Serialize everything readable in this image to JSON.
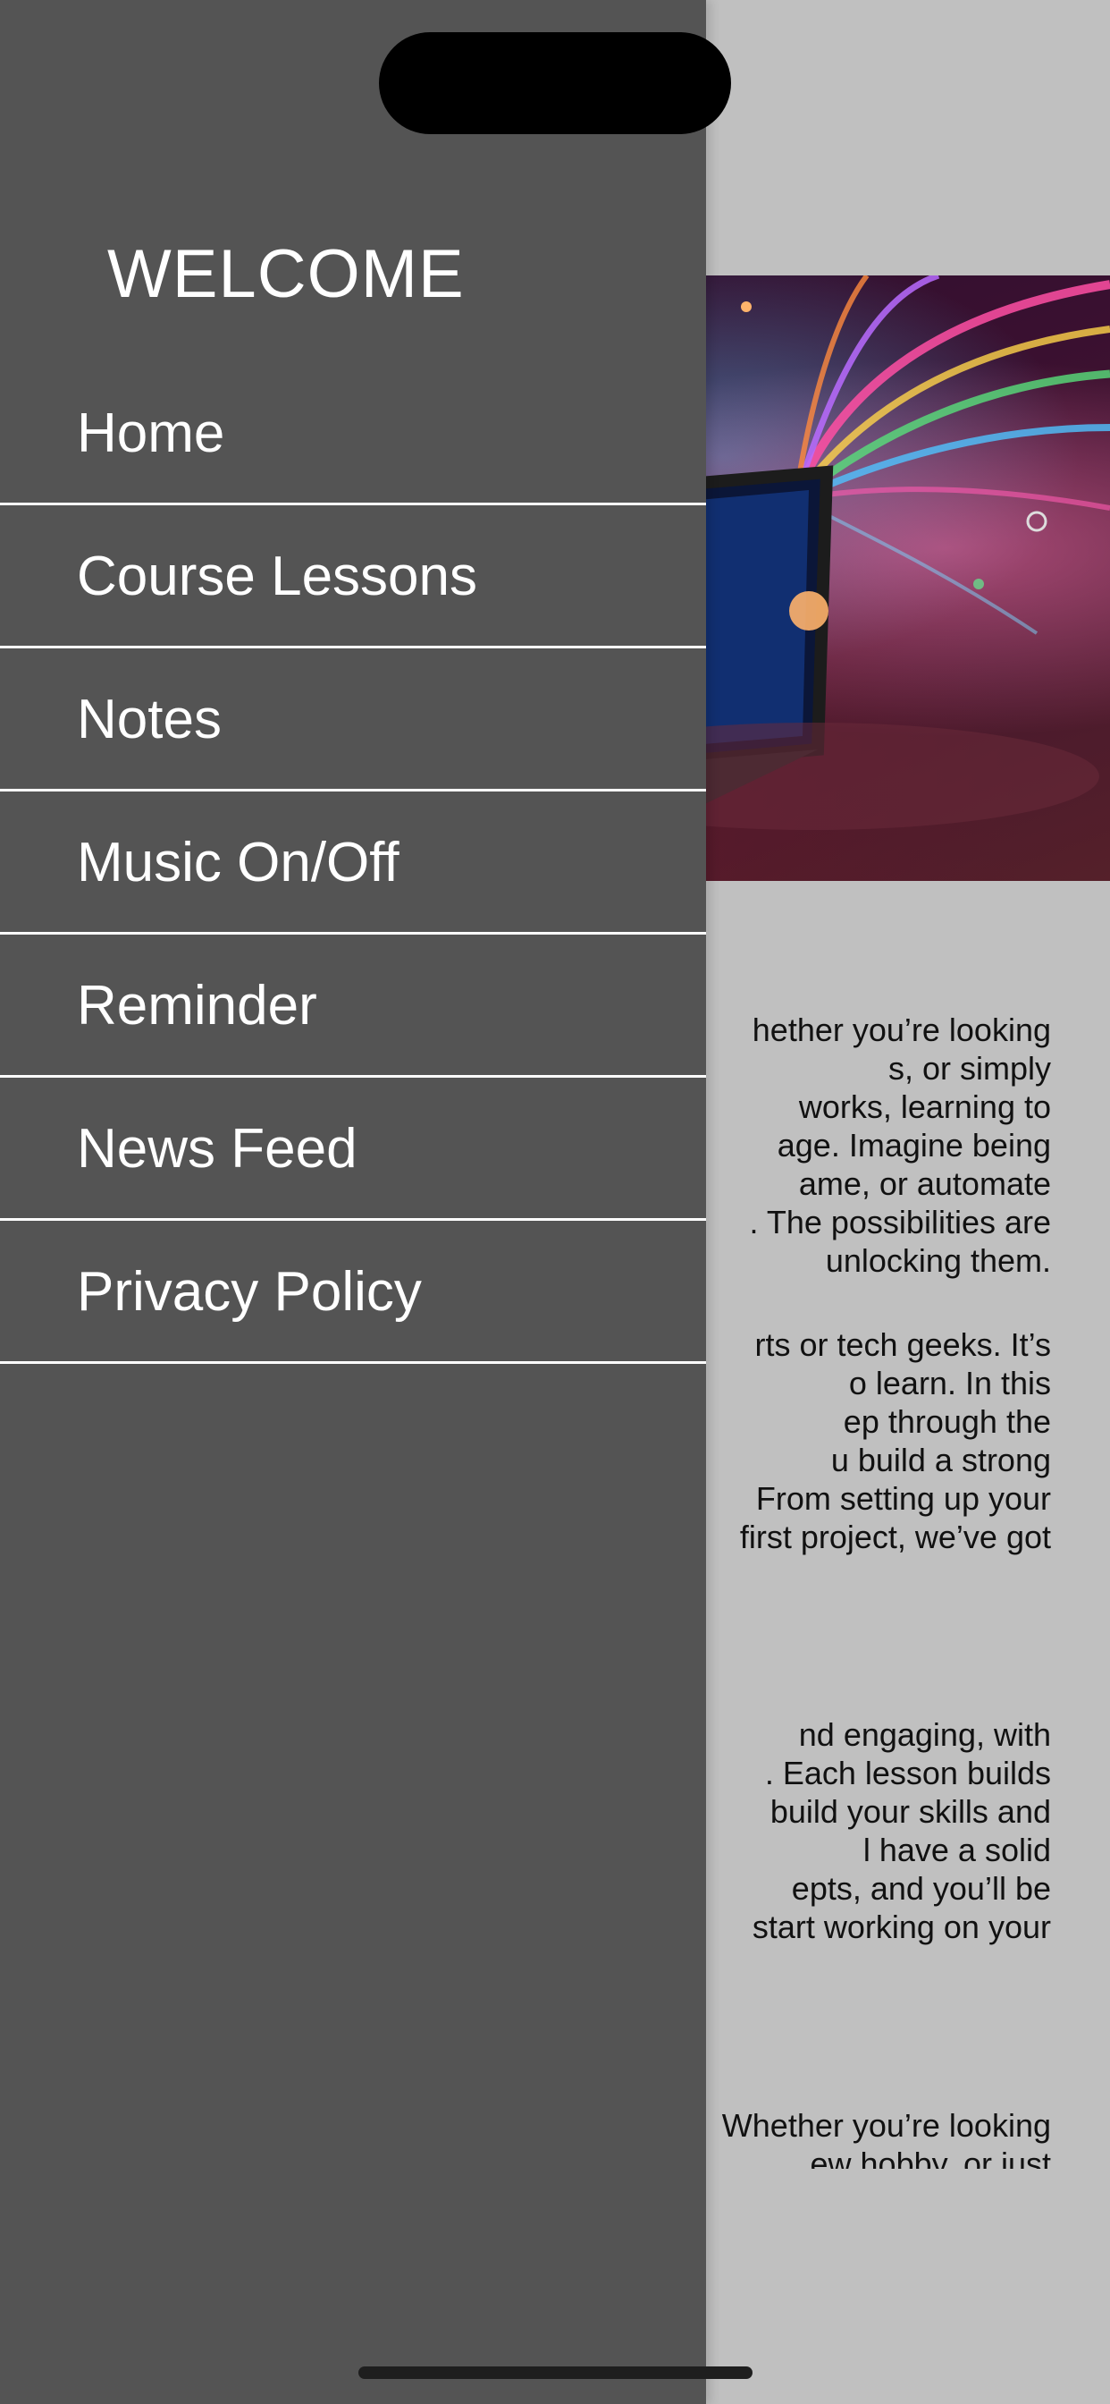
{
  "menu": {
    "title": "WELCOME",
    "items": [
      {
        "label": "Home"
      },
      {
        "label": "Course Lessons"
      },
      {
        "label": "Notes"
      },
      {
        "label": "Music On/Off"
      },
      {
        "label": "Reminder"
      },
      {
        "label": "News Feed"
      },
      {
        "label": "Privacy Policy"
      }
    ]
  },
  "content": {
    "paragraph_1": [
      "hether you’re looking",
      "s, or simply",
      "works, learning to",
      "age. Imagine being",
      "ame, or automate",
      ". The possibilities are",
      "unlocking them."
    ],
    "paragraph_2": [
      "rts or tech geeks. It’s",
      "o learn. In this",
      "ep through the",
      "u build a strong",
      "From setting up your",
      "first project, we’ve got"
    ],
    "paragraph_3": [
      "nd engaging, with",
      ". Each lesson builds",
      "build your skills and",
      "l have a solid",
      "epts, and you’ll be",
      "start working on your"
    ],
    "paragraph_4": [
      "Whether you’re looking",
      "ew hobby, or just"
    ]
  },
  "colors": {
    "menu_background": "#545454",
    "page_background": "#c0c0c0",
    "menu_text": "#ffffff",
    "divider": "#ffffff"
  }
}
